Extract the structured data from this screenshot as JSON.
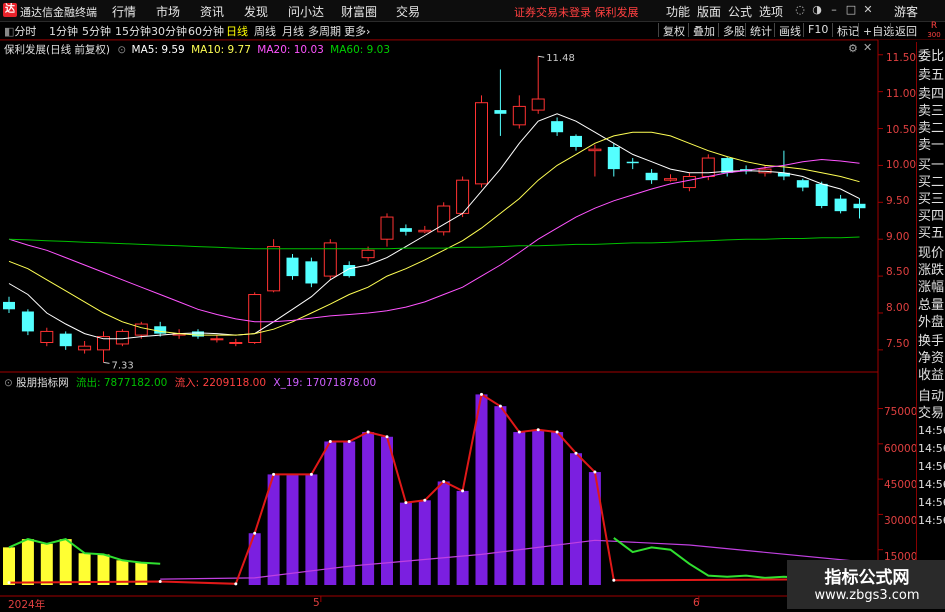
{
  "menubar": {
    "app_title": "通达信金融终端",
    "items": [
      "行情",
      "市场",
      "资讯",
      "发现",
      "问小达",
      "财富圈",
      "交易"
    ],
    "notice": "证券交易未登录  保利发展",
    "right_items": [
      "功能",
      "版面",
      "公式",
      "选项"
    ],
    "user": "游客"
  },
  "toolbar": {
    "periods": [
      "分时",
      "1分钟",
      "5分钟",
      "15分钟",
      "30分钟",
      "60分钟",
      "日线",
      "周线",
      "月线",
      "多周期",
      "更多"
    ],
    "active_period": "日线",
    "buttons": [
      "复权",
      "叠加",
      "多股",
      "统计",
      "画线",
      "F10",
      "标记",
      "+自选",
      "返回"
    ],
    "r_label": "R",
    "r_num": "300"
  },
  "price_panel": {
    "title": "保利发展(日线 前复权)",
    "ma5": "MA5: 9.59",
    "ma10": "MA10: 9.77",
    "ma20": "MA20: 10.03",
    "ma60": "MA60: 9.03",
    "high_label": "11.48",
    "low_label": "7.33",
    "y_ticks": [
      "11.50",
      "11.00",
      "10.50",
      "10.00",
      "9.50",
      "9.00",
      "8.50",
      "8.00",
      "7.50"
    ]
  },
  "indicator_panel": {
    "name": "股朋指标网",
    "inflow_out": "流出: 7877182.00",
    "inflow_in": "流入: 2209118.00",
    "x19": "X_19: 17071878.00",
    "y_ticks": [
      "75000",
      "60000",
      "45000",
      "30000",
      "15000"
    ]
  },
  "x_axis": {
    "labels": [
      "2024年",
      "5",
      "6"
    ]
  },
  "quote_panel": {
    "items": [
      "委比",
      "卖五",
      "卖四",
      "卖三",
      "卖二",
      "卖一",
      "买一",
      "买二",
      "买三",
      "买四",
      "买五",
      "现价",
      "涨跌",
      "涨幅",
      "总量",
      "外盘",
      "换手",
      "净资",
      "收益",
      "自动",
      "交易"
    ],
    "times": [
      "14:56",
      "14:56",
      "14:56",
      "14:56",
      "14:56",
      "14:56"
    ]
  },
  "watermark": {
    "line1": "指标公式网",
    "line2": "www.zbgs3.com"
  },
  "colors": {
    "up": "#ff3232",
    "down": "#54ffff",
    "ma5": "#ffffff",
    "ma10": "#ffff54",
    "ma20": "#ff54ff",
    "ma60": "#00c000",
    "bar": "#7b1fe0",
    "axis_red": "#e04040"
  },
  "chart_data": [
    {
      "type": "candlestick",
      "title": "保利发展(日线 前复权)",
      "ylim": [
        7.2,
        11.7
      ],
      "candles": [
        {
          "o": 8.15,
          "c": 8.05,
          "h": 8.22,
          "l": 8.0
        },
        {
          "o": 8.02,
          "c": 7.75,
          "h": 8.05,
          "l": 7.7
        },
        {
          "o": 7.6,
          "c": 7.75,
          "h": 7.8,
          "l": 7.55
        },
        {
          "o": 7.72,
          "c": 7.55,
          "h": 7.75,
          "l": 7.5
        },
        {
          "o": 7.5,
          "c": 7.55,
          "h": 7.62,
          "l": 7.45
        },
        {
          "o": 7.5,
          "c": 7.68,
          "h": 7.75,
          "l": 7.33
        },
        {
          "o": 7.58,
          "c": 7.75,
          "h": 7.78,
          "l": 7.55
        },
        {
          "o": 7.7,
          "c": 7.85,
          "h": 7.88,
          "l": 7.65
        },
        {
          "o": 7.82,
          "c": 7.72,
          "h": 7.88,
          "l": 7.68
        },
        {
          "o": 7.7,
          "c": 7.72,
          "h": 7.78,
          "l": 7.65
        },
        {
          "o": 7.75,
          "c": 7.68,
          "h": 7.78,
          "l": 7.65
        },
        {
          "o": 7.65,
          "c": 7.65,
          "h": 7.7,
          "l": 7.6
        },
        {
          "o": 7.6,
          "c": 7.6,
          "h": 7.65,
          "l": 7.55
        },
        {
          "o": 7.6,
          "c": 8.25,
          "h": 8.28,
          "l": 7.58
        },
        {
          "o": 8.3,
          "c": 8.9,
          "h": 9.0,
          "l": 8.28
        },
        {
          "o": 8.75,
          "c": 8.5,
          "h": 8.8,
          "l": 8.45
        },
        {
          "o": 8.7,
          "c": 8.4,
          "h": 8.75,
          "l": 8.35
        },
        {
          "o": 8.5,
          "c": 8.95,
          "h": 9.0,
          "l": 8.45
        },
        {
          "o": 8.65,
          "c": 8.5,
          "h": 8.7,
          "l": 8.48
        },
        {
          "o": 8.75,
          "c": 8.85,
          "h": 8.9,
          "l": 8.7
        },
        {
          "o": 9.0,
          "c": 9.3,
          "h": 9.35,
          "l": 8.9
        },
        {
          "o": 9.15,
          "c": 9.1,
          "h": 9.2,
          "l": 9.05
        },
        {
          "o": 9.1,
          "c": 9.12,
          "h": 9.18,
          "l": 9.08
        },
        {
          "o": 9.1,
          "c": 9.45,
          "h": 9.5,
          "l": 9.05
        },
        {
          "o": 9.35,
          "c": 9.8,
          "h": 9.85,
          "l": 9.3
        },
        {
          "o": 9.75,
          "c": 10.85,
          "h": 10.95,
          "l": 9.7
        },
        {
          "o": 10.75,
          "c": 10.7,
          "h": 11.3,
          "l": 10.4
        },
        {
          "o": 10.55,
          "c": 10.8,
          "h": 10.95,
          "l": 10.5
        },
        {
          "o": 10.75,
          "c": 10.9,
          "h": 11.48,
          "l": 10.7
        },
        {
          "o": 10.6,
          "c": 10.45,
          "h": 10.65,
          "l": 10.4
        },
        {
          "o": 10.4,
          "c": 10.25,
          "h": 10.42,
          "l": 10.2
        },
        {
          "o": 10.2,
          "c": 10.22,
          "h": 10.28,
          "l": 9.85
        },
        {
          "o": 10.25,
          "c": 9.95,
          "h": 10.3,
          "l": 9.85
        },
        {
          "o": 10.05,
          "c": 10.03,
          "h": 10.1,
          "l": 9.95
        },
        {
          "o": 9.9,
          "c": 9.8,
          "h": 9.95,
          "l": 9.75
        },
        {
          "o": 9.8,
          "c": 9.82,
          "h": 9.88,
          "l": 9.78
        },
        {
          "o": 9.7,
          "c": 9.85,
          "h": 9.9,
          "l": 9.65
        },
        {
          "o": 9.85,
          "c": 10.1,
          "h": 10.15,
          "l": 9.8
        },
        {
          "o": 10.1,
          "c": 9.9,
          "h": 10.12,
          "l": 9.85
        },
        {
          "o": 9.95,
          "c": 9.92,
          "h": 10.0,
          "l": 9.88
        },
        {
          "o": 9.9,
          "c": 9.95,
          "h": 10.0,
          "l": 9.85
        },
        {
          "o": 9.9,
          "c": 9.85,
          "h": 10.2,
          "l": 9.8
        },
        {
          "o": 9.8,
          "c": 9.7,
          "h": 9.82,
          "l": 9.65
        },
        {
          "o": 9.75,
          "c": 9.45,
          "h": 9.78,
          "l": 9.42
        },
        {
          "o": 9.55,
          "c": 9.38,
          "h": 9.6,
          "l": 9.35
        },
        {
          "o": 9.48,
          "c": 9.42,
          "h": 9.55,
          "l": 9.28
        }
      ],
      "series": [
        {
          "name": "MA5",
          "values": [
            8.4,
            8.25,
            8.0,
            7.85,
            7.72,
            7.65,
            7.65,
            7.68,
            7.7,
            7.72,
            7.73,
            7.72,
            7.7,
            7.72,
            7.88,
            8.05,
            8.22,
            8.45,
            8.6,
            8.65,
            8.75,
            8.9,
            9.05,
            9.2,
            9.35,
            9.65,
            9.95,
            10.3,
            10.6,
            10.7,
            10.6,
            10.45,
            10.3,
            10.15,
            10.05,
            9.95,
            9.9,
            9.9,
            9.92,
            9.93,
            9.92,
            9.9,
            9.85,
            9.75,
            9.68,
            9.55
          ]
        },
        {
          "name": "MA10",
          "values": [
            8.7,
            8.6,
            8.45,
            8.3,
            8.15,
            8.0,
            7.88,
            7.8,
            7.75,
            7.72,
            7.7,
            7.7,
            7.7,
            7.72,
            7.78,
            7.88,
            8.0,
            8.12,
            8.25,
            8.35,
            8.5,
            8.6,
            8.72,
            8.85,
            8.98,
            9.15,
            9.35,
            9.55,
            9.8,
            10.0,
            10.15,
            10.3,
            10.4,
            10.45,
            10.45,
            10.4,
            10.3,
            10.2,
            10.12,
            10.05,
            10.0,
            9.98,
            9.95,
            9.9,
            9.85,
            9.78
          ]
        },
        {
          "name": "MA20",
          "values": [
            9.0,
            8.92,
            8.85,
            8.75,
            8.65,
            8.55,
            8.45,
            8.35,
            8.25,
            8.15,
            8.05,
            7.98,
            7.92,
            7.88,
            7.88,
            7.9,
            7.93,
            7.96,
            7.98,
            8.0,
            8.03,
            8.08,
            8.15,
            8.25,
            8.35,
            8.5,
            8.65,
            8.82,
            9.0,
            9.15,
            9.3,
            9.42,
            9.52,
            9.6,
            9.68,
            9.75,
            9.8,
            9.85,
            9.9,
            9.93,
            9.97,
            10.0,
            10.05,
            10.08,
            10.06,
            10.03
          ]
        },
        {
          "name": "MA60",
          "values": [
            9.0,
            8.99,
            8.98,
            8.97,
            8.96,
            8.95,
            8.94,
            8.93,
            8.92,
            8.91,
            8.9,
            8.89,
            8.88,
            8.87,
            8.87,
            8.87,
            8.87,
            8.87,
            8.87,
            8.87,
            8.87,
            8.88,
            8.88,
            8.88,
            8.89,
            8.89,
            8.9,
            8.91,
            8.91,
            8.92,
            8.93,
            8.93,
            8.94,
            8.95,
            8.95,
            8.96,
            8.97,
            8.98,
            8.99,
            9.0,
            9.0,
            9.01,
            9.01,
            9.02,
            9.02,
            9.03
          ]
        }
      ]
    },
    {
      "type": "bar",
      "title": "股朋指标网",
      "ylim": [
        0,
        85000
      ],
      "purple_bars": [
        {
          "i": 13,
          "v": 22000
        },
        {
          "i": 14,
          "v": 47000
        },
        {
          "i": 15,
          "v": 47000
        },
        {
          "i": 16,
          "v": 47000
        },
        {
          "i": 17,
          "v": 61000
        },
        {
          "i": 18,
          "v": 61000
        },
        {
          "i": 19,
          "v": 65000
        },
        {
          "i": 20,
          "v": 63000
        },
        {
          "i": 21,
          "v": 35000
        },
        {
          "i": 22,
          "v": 36000
        },
        {
          "i": 23,
          "v": 44000
        },
        {
          "i": 24,
          "v": 40000
        },
        {
          "i": 25,
          "v": 81000
        },
        {
          "i": 26,
          "v": 76000
        },
        {
          "i": 27,
          "v": 65000
        },
        {
          "i": 28,
          "v": 66000
        },
        {
          "i": 29,
          "v": 65000
        },
        {
          "i": 30,
          "v": 56000
        },
        {
          "i": 31,
          "v": 48000
        }
      ],
      "yellow_bars": [
        {
          "i": 0,
          "v": 16000
        },
        {
          "i": 1,
          "v": 19500
        },
        {
          "i": 2,
          "v": 17500
        },
        {
          "i": 3,
          "v": 19500
        },
        {
          "i": 4,
          "v": 13500
        },
        {
          "i": 5,
          "v": 13000
        },
        {
          "i": 6,
          "v": 10500
        },
        {
          "i": 7,
          "v": 9500
        }
      ],
      "green_line": [
        {
          "i": 0,
          "v": 16000
        },
        {
          "i": 1,
          "v": 19500
        },
        {
          "i": 2,
          "v": 17500
        },
        {
          "i": 3,
          "v": 19500
        },
        {
          "i": 4,
          "v": 13500
        },
        {
          "i": 5,
          "v": 13000
        },
        {
          "i": 6,
          "v": 10500
        },
        {
          "i": 7,
          "v": 9500
        },
        {
          "i": 8,
          "v": 9000
        }
      ],
      "green_line_right": [
        {
          "i": 32,
          "v": 20000
        },
        {
          "i": 33,
          "v": 14000
        },
        {
          "i": 34,
          "v": 16000
        },
        {
          "i": 35,
          "v": 15000
        },
        {
          "i": 36,
          "v": 9000
        },
        {
          "i": 37,
          "v": 4000
        },
        {
          "i": 38,
          "v": 3500
        },
        {
          "i": 39,
          "v": 4000
        },
        {
          "i": 40,
          "v": 3000
        },
        {
          "i": 41,
          "v": 3500
        },
        {
          "i": 42,
          "v": 3000
        },
        {
          "i": 43,
          "v": 3500
        },
        {
          "i": 44,
          "v": 3500
        },
        {
          "i": 45,
          "v": 3000
        }
      ],
      "magenta_line": [
        {
          "i": 8,
          "v": 2500
        },
        {
          "i": 13,
          "v": 3000
        },
        {
          "i": 18,
          "v": 8000
        },
        {
          "i": 25,
          "v": 13000
        },
        {
          "i": 31,
          "v": 19000
        },
        {
          "i": 36,
          "v": 17000
        },
        {
          "i": 45,
          "v": 10000
        }
      ],
      "red_line": [
        {
          "i": 0,
          "v": 1000
        },
        {
          "i": 8,
          "v": 1500
        },
        {
          "i": 12,
          "v": 500
        },
        {
          "i": 13,
          "v": 22000
        },
        {
          "i": 14,
          "v": 47000
        },
        {
          "i": 16,
          "v": 47000
        },
        {
          "i": 17,
          "v": 61000
        },
        {
          "i": 18,
          "v": 61000
        },
        {
          "i": 19,
          "v": 65000
        },
        {
          "i": 20,
          "v": 63000
        },
        {
          "i": 21,
          "v": 35000
        },
        {
          "i": 22,
          "v": 36000
        },
        {
          "i": 23,
          "v": 44000
        },
        {
          "i": 24,
          "v": 40000
        },
        {
          "i": 25,
          "v": 81000
        },
        {
          "i": 26,
          "v": 76000
        },
        {
          "i": 27,
          "v": 65000
        },
        {
          "i": 28,
          "v": 66000
        },
        {
          "i": 29,
          "v": 65000
        },
        {
          "i": 30,
          "v": 56000
        },
        {
          "i": 31,
          "v": 48000
        },
        {
          "i": 32,
          "v": 2000
        },
        {
          "i": 45,
          "v": 2500
        }
      ]
    }
  ]
}
